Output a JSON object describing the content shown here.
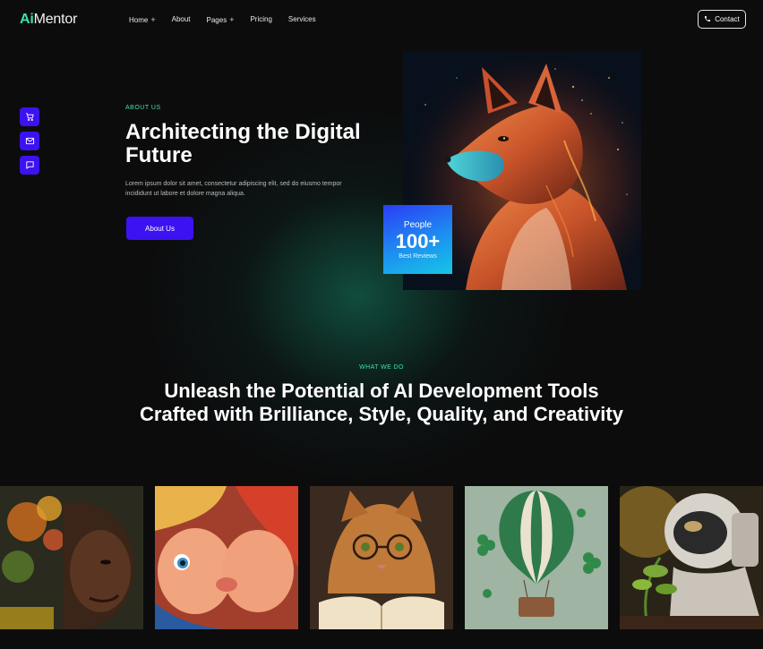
{
  "brand": {
    "logo_prefix": "Ai",
    "logo_suffix": "Mentor",
    "accent_color": "#3fe0a8",
    "primary_color": "#3d12f0"
  },
  "nav": {
    "items": [
      {
        "label": "Home",
        "has_submenu": true
      },
      {
        "label": "About",
        "has_submenu": false
      },
      {
        "label": "Pages",
        "has_submenu": true
      },
      {
        "label": "Pricing",
        "has_submenu": false
      },
      {
        "label": "Services",
        "has_submenu": false
      }
    ],
    "submenu_symbol": "+",
    "contact_label": "Contact",
    "contact_icon": "phone-icon"
  },
  "side_icons": [
    "cart-icon",
    "mail-icon",
    "chat-icon"
  ],
  "hero": {
    "eyebrow": "ABOUT US",
    "title": "Architecting the Digital Future",
    "description": "Lorem ipsum dolor sit amet, consectetur adipiscing elit, sed do eiusmo tempor incididunt ut labore et dolore magna aliqua.",
    "button_label": "About Us"
  },
  "stats": {
    "label": "People",
    "value": "100+",
    "sub": "Best Reviews"
  },
  "section": {
    "eyebrow": "WHAT WE DO",
    "title": "Unleash the Potential of AI Development Tools Crafted with Brilliance, Style, Quality, and Creativity"
  },
  "gallery": {
    "items": [
      {
        "name": "woman-with-flowers-image"
      },
      {
        "name": "cartoon-children-kiss-image"
      },
      {
        "name": "cat-reading-book-image"
      },
      {
        "name": "hot-air-balloon-clover-image"
      },
      {
        "name": "astronaut-plant-image"
      }
    ]
  }
}
